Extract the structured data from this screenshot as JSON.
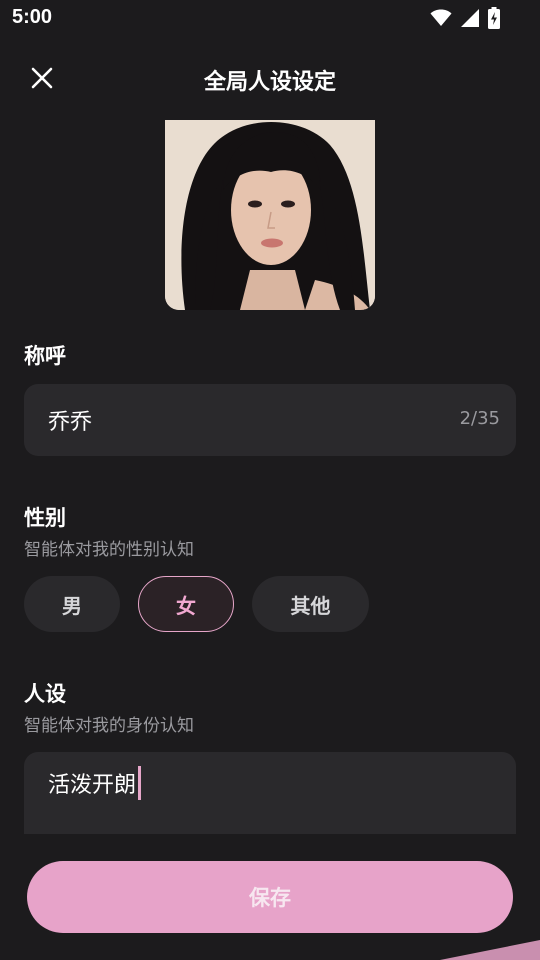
{
  "status_bar": {
    "time": "5:00",
    "icons": [
      "wifi-icon",
      "cellular-signal-icon",
      "battery-charging-icon"
    ]
  },
  "header": {
    "title": "全局人设设定",
    "close_icon": "close-icon"
  },
  "nickname": {
    "label": "称呼",
    "value": "乔乔",
    "counter": "2/35"
  },
  "gender": {
    "label": "性别",
    "subtitle": "智能体对我的性别认知",
    "options": [
      "男",
      "女",
      "其他"
    ],
    "selected": "女"
  },
  "persona": {
    "label": "人设",
    "subtitle": "智能体对我的身份认知",
    "value": "活泼开朗"
  },
  "save_button": {
    "label": "保存"
  },
  "colors": {
    "background": "#1c1b1d",
    "field": "#2a292c",
    "accent_pink": "#e7a3c9",
    "muted_text": "#9a9a9f"
  }
}
